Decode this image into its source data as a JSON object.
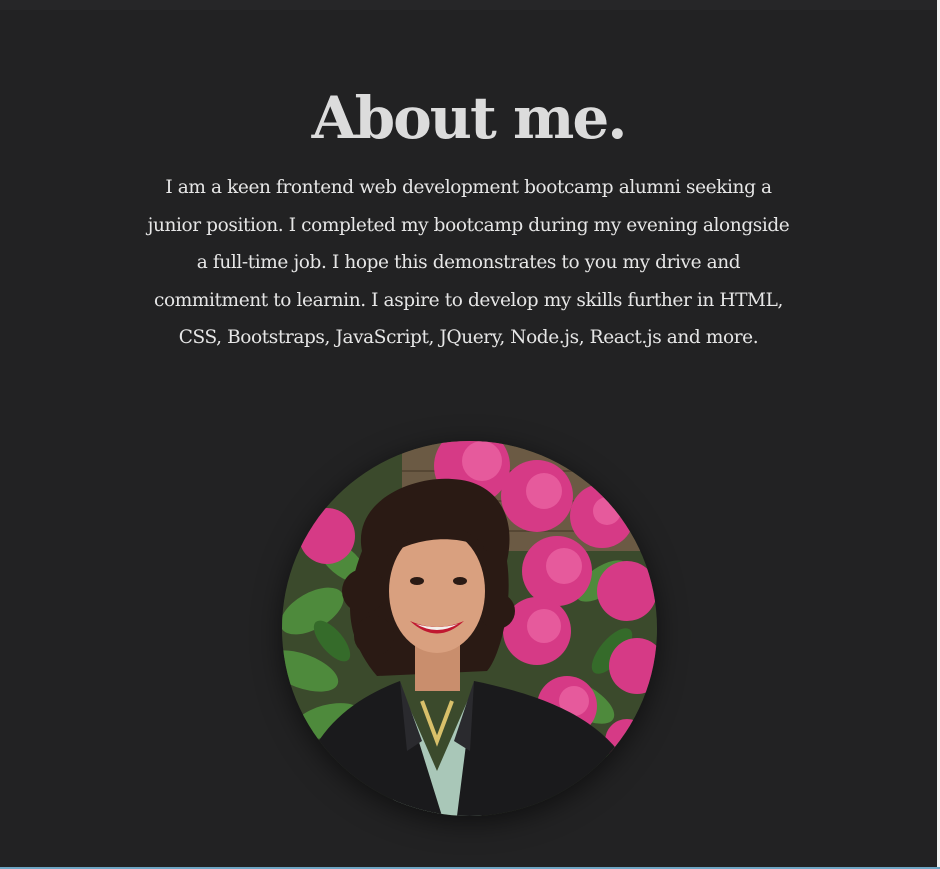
{
  "about": {
    "title": "About me.",
    "bio": "I am a keen frontend web development bootcamp alumni seeking a junior position. I completed my bootcamp during my evening alongside a full-time job. I hope this demonstrates to you my drive and commitment to learnin. I aspire to develop my skills further in HTML, CSS, Bootstraps, JavaScript, JQuery, Node.js, React.js and more."
  },
  "colors": {
    "background": "#222223",
    "title": "#dcdcdc",
    "text": "#e6e6e6",
    "flowers": "#d63a86",
    "leaves": "#4e8a3c",
    "jacket": "#1a1a1c",
    "skin": "#d9a07f",
    "hair": "#2a1a14"
  }
}
